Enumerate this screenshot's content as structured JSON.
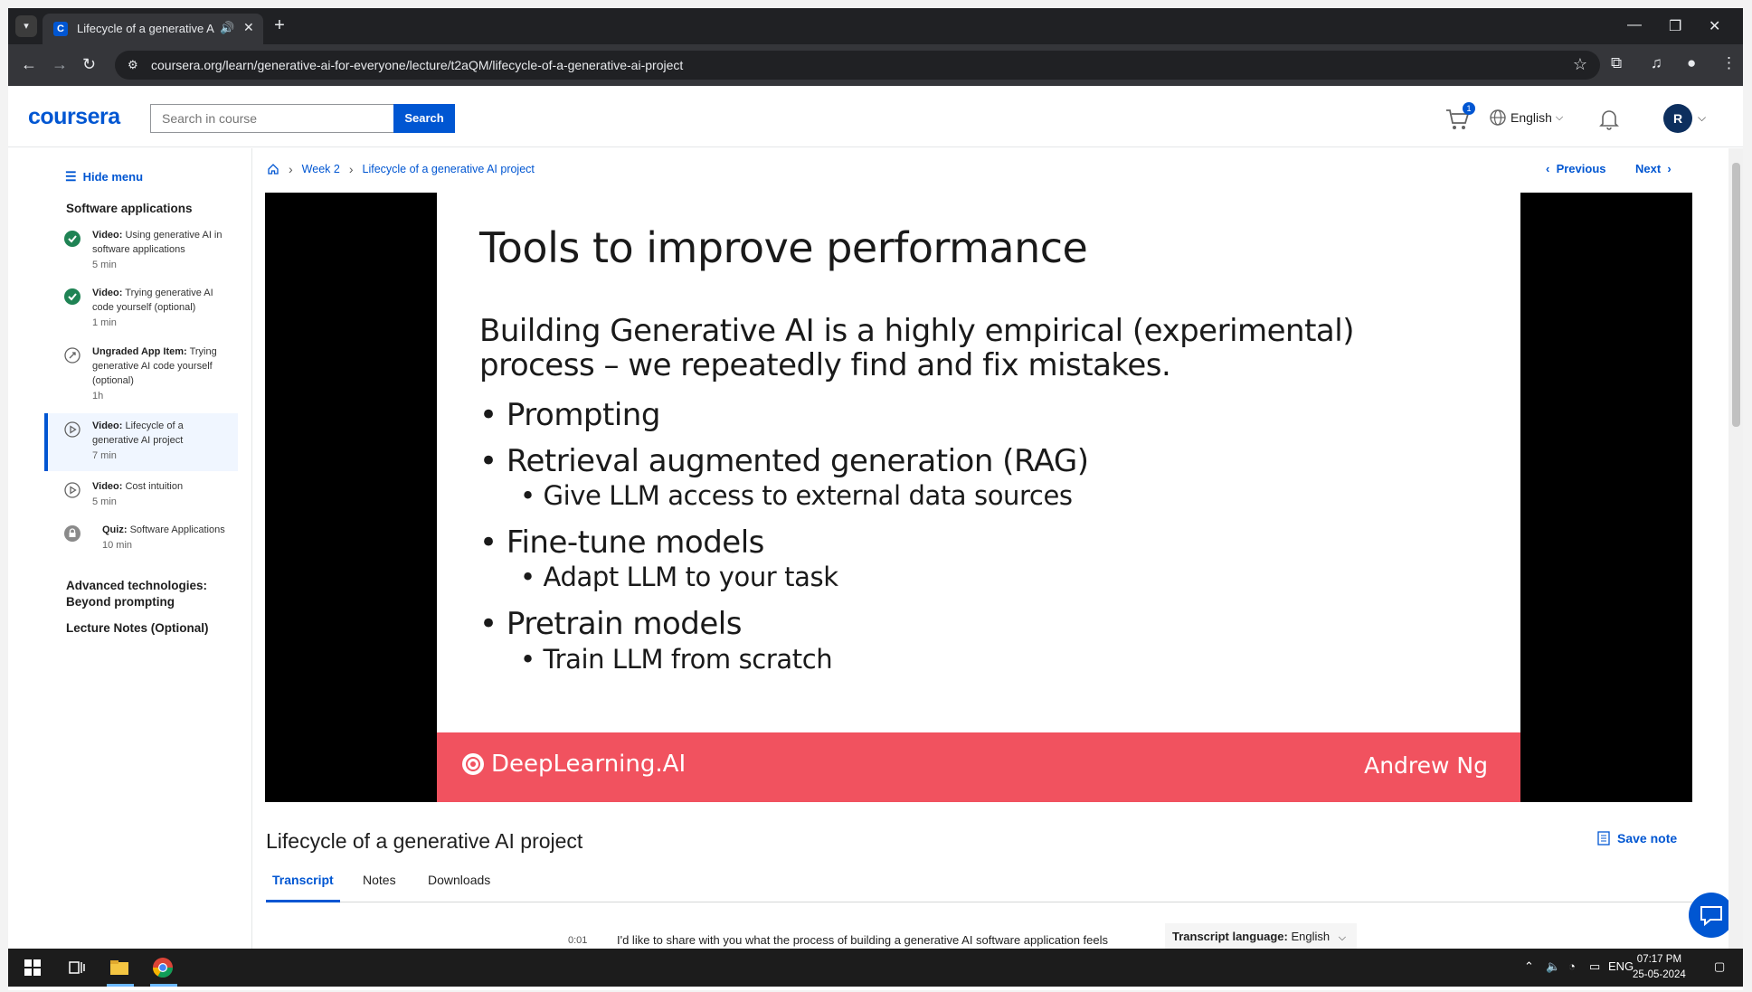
{
  "browser": {
    "tab_title": "Lifecycle of a generative AI",
    "url": "coursera.org/learn/generative-ai-for-everyone/lecture/t2aQM/lifecycle-of-a-generative-ai-project"
  },
  "header": {
    "logo": "coursera",
    "search_placeholder": "Search in course",
    "search_button": "Search",
    "cart_count": "1",
    "language": "English",
    "avatar_initial": "R"
  },
  "sidebar": {
    "hide_menu": "Hide menu",
    "section_title": "Software applications",
    "items": [
      {
        "kind": "Video:",
        "title": "Using generative AI in software applications",
        "duration": "5 min",
        "status": "completed"
      },
      {
        "kind": "Video:",
        "title": "Trying generative AI code yourself (optional)",
        "duration": "1 min",
        "status": "completed"
      },
      {
        "kind": "Ungraded App Item:",
        "title": "Trying generative AI code yourself (optional)",
        "duration": "1h",
        "status": "app"
      },
      {
        "kind": "Video:",
        "title": "Lifecycle of a generative AI project",
        "duration": "7 min",
        "status": "current"
      },
      {
        "kind": "Video:",
        "title": "Cost intuition",
        "duration": "5 min",
        "status": "video"
      },
      {
        "kind": "Quiz:",
        "title": "Software Applications",
        "duration": "10 min",
        "status": "locked"
      }
    ],
    "section_2": "Advanced technologies: Beyond prompting",
    "section_3": "Lecture Notes (Optional)"
  },
  "breadcrumb": {
    "week": "Week 2",
    "lecture": "Lifecycle of a generative AI project"
  },
  "nav": {
    "previous": "Previous",
    "next": "Next"
  },
  "slide": {
    "title": "Tools to improve performance",
    "intro": "Building Generative AI is a highly empirical (experimental) process – we repeatedly find and fix mistakes.",
    "bullets": [
      {
        "text": "Prompting",
        "level": 1
      },
      {
        "text": "Retrieval augmented generation (RAG)",
        "level": 1
      },
      {
        "text": "Give LLM access to external data sources",
        "level": 2
      },
      {
        "text": "Fine-tune models",
        "level": 1
      },
      {
        "text": "Adapt LLM to your task",
        "level": 2
      },
      {
        "text": "Pretrain models",
        "level": 1
      },
      {
        "text": "Train LLM from scratch",
        "level": 2
      }
    ],
    "brand": "DeepLearning.AI",
    "presenter": "Andrew Ng"
  },
  "lecture": {
    "title": "Lifecycle of a generative AI project",
    "save_note": "Save note",
    "tabs": [
      "Transcript",
      "Notes",
      "Downloads"
    ],
    "transcript_time": "0:01",
    "transcript_line": "I'd like to share with you what the process of building a generative AI software application feels",
    "transcript_language_label": "Transcript language:",
    "transcript_language": "English"
  },
  "taskbar": {
    "lang": "ENG",
    "time": "07:17 PM",
    "date": "25-05-2024"
  },
  "colors": {
    "accent": "#0056d2",
    "success": "#1f8354",
    "slide_footer": "#f1525f"
  }
}
